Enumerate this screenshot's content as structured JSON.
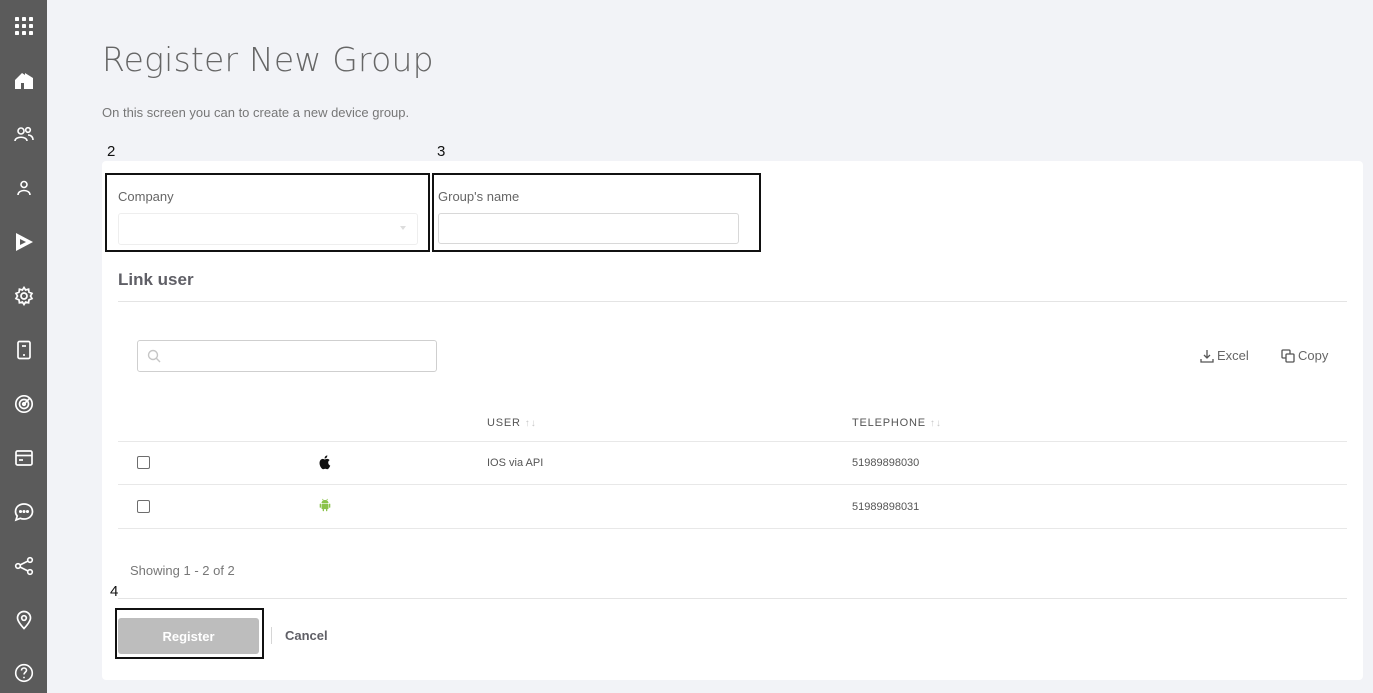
{
  "sidebar": {
    "icons": [
      "apps-grid-icon",
      "home-icon",
      "users-icon",
      "user-icon",
      "deploy-play-icon",
      "settings-gear-icon",
      "device-tablet-icon",
      "radar-icon",
      "browser-window-icon",
      "chat-bubble-icon",
      "share-icon",
      "location-pin-icon",
      "help-icon"
    ]
  },
  "page": {
    "title": "Register New Group",
    "description": "On this screen you can to create a new device group."
  },
  "annotations": [
    "2",
    "3",
    "4"
  ],
  "form": {
    "company_label": "Company",
    "company_value": "",
    "group_name_label": "Group's name",
    "group_name_value": "",
    "group_name_placeholder": ""
  },
  "link_user": {
    "title": "Link user",
    "search_placeholder": "",
    "excel_label": "Excel",
    "copy_label": "Copy",
    "columns": [
      "USER",
      "TELEPHONE"
    ],
    "sort_indicator": "↑↓",
    "rows": [
      {
        "os": "apple-icon",
        "user": "IOS via API",
        "telephone": "51989898030"
      },
      {
        "os": "android-icon",
        "user": "",
        "telephone": "51989898031"
      }
    ],
    "showing": "Showing 1 - 2 of 2"
  },
  "actions": {
    "register_label": "Register",
    "cancel_label": "Cancel"
  },
  "colors": {
    "sidebar": "#5b5b5b",
    "android_green": "#8bc34a",
    "register_disabled": "#bdbdbd"
  }
}
